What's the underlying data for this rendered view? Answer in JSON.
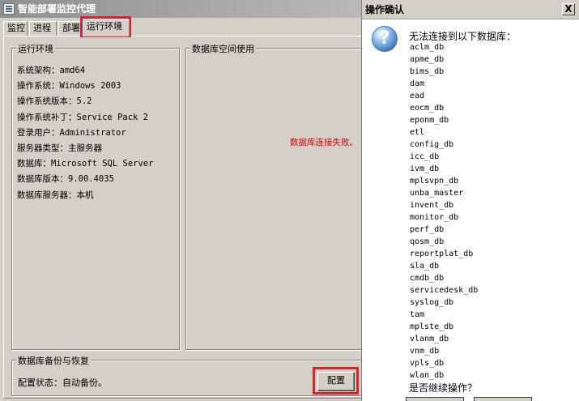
{
  "window": {
    "title": "智能部署监控代理"
  },
  "tabs": [
    {
      "label": "监控"
    },
    {
      "label": "进程"
    },
    {
      "label": "部署"
    },
    {
      "label": "运行环境"
    }
  ],
  "runtime_env": {
    "title": "运行环境",
    "rows": [
      "系统架构：amd64",
      "操作系统：Windows 2003",
      "操作系统版本：5.2",
      "操作系统补丁：Service Pack 2",
      "登录用户：Administrator",
      "服务器类型：主服务器",
      "数据库：Microsoft SQL Server",
      "数据库版本：9.00.4035",
      "数据库服务器：本机"
    ]
  },
  "db_space": {
    "title": "数据库空间使用",
    "error": "数据库连接失败。"
  },
  "backup": {
    "title": "数据库备份与恢复",
    "status": "配置状态：自动备份。",
    "config_label": "配置"
  },
  "dialog": {
    "title": "操作确认",
    "close_glyph": "X",
    "icon_glyph": "?",
    "message": "无法连接到以下数据库：",
    "databases": [
      "aclm_db",
      "apme_db",
      "bims_db",
      "dam",
      "ead",
      "eocm_db",
      "eponm_db",
      "etl",
      "config_db",
      "icc_db",
      "ivm_db",
      "mplsvpn_db",
      "unba_master",
      "invent_db",
      "monitor_db",
      "perf_db",
      "qosm_db",
      "reportplat_db",
      "sla_db",
      "cmdb_db",
      "servicedesk_db",
      "syslog_db",
      "tam",
      "mplste_db",
      "vlanm_db",
      "vnm_db",
      "vpls_db",
      "wlan_db"
    ],
    "question": "是否继续操作？"
  },
  "colors": {
    "highlight": "#e0202a",
    "error": "#e00000"
  }
}
